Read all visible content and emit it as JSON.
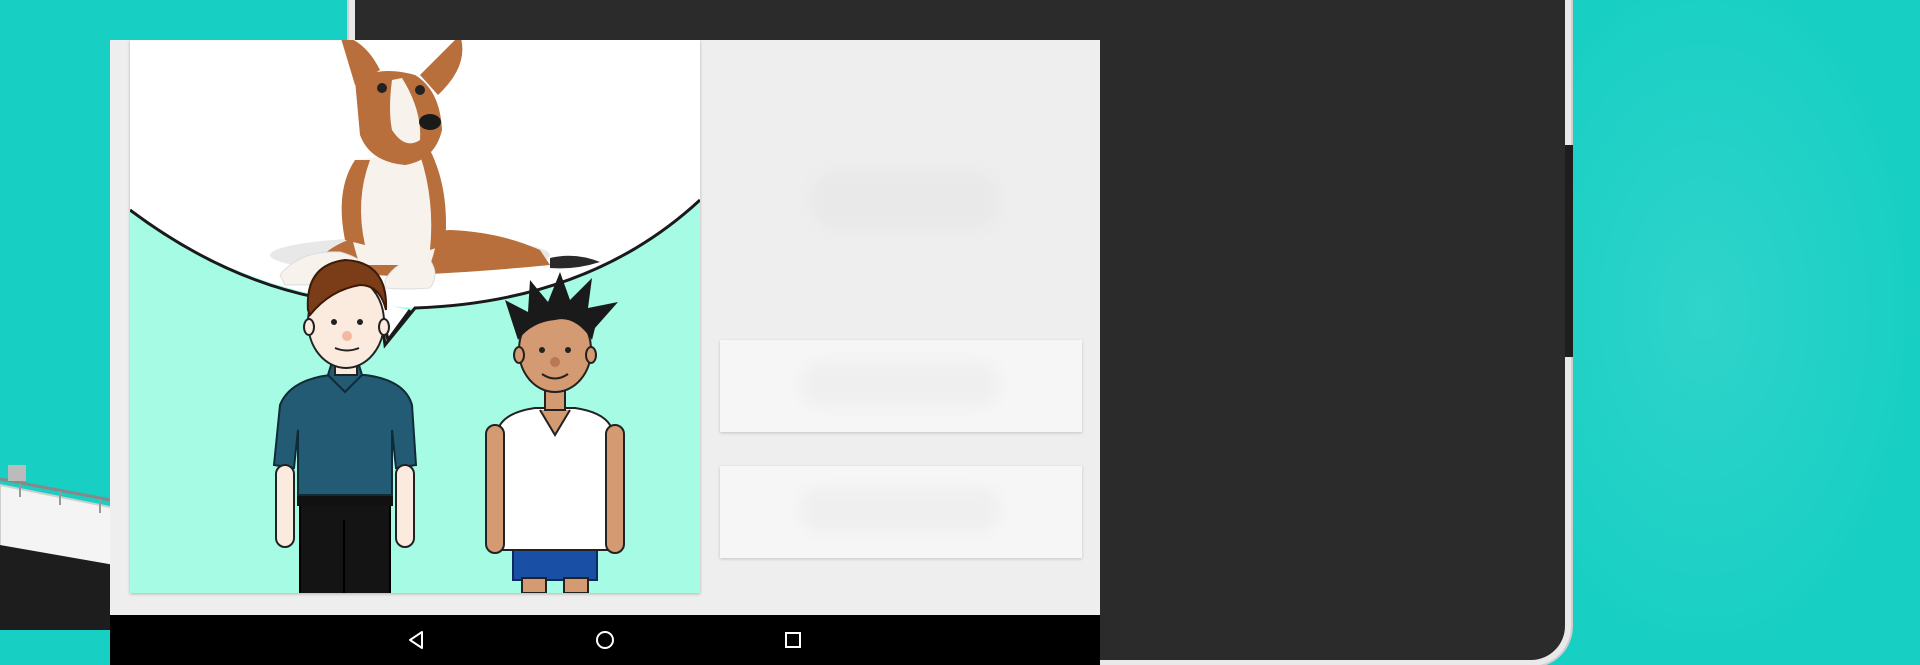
{
  "colors": {
    "background": "#18cfc4",
    "comic_ground": "#a5fbe3",
    "tablet_bezel": "#2b2b2b",
    "screen_bg": "#eeeeee",
    "navbar": "#000000"
  },
  "comic": {
    "subject": "dog-in-speech-bubble",
    "characters": [
      "man-brown-hair-blue-shirt",
      "boy-spiky-black-hair-white-shirt"
    ]
  },
  "navigation": {
    "buttons": [
      {
        "name": "back-button",
        "icon": "triangle-back-icon"
      },
      {
        "name": "home-button",
        "icon": "circle-home-icon"
      },
      {
        "name": "recents-button",
        "icon": "square-recents-icon"
      }
    ]
  },
  "answer_cards": [
    {
      "name": "answer-card-1"
    },
    {
      "name": "answer-card-2"
    }
  ]
}
